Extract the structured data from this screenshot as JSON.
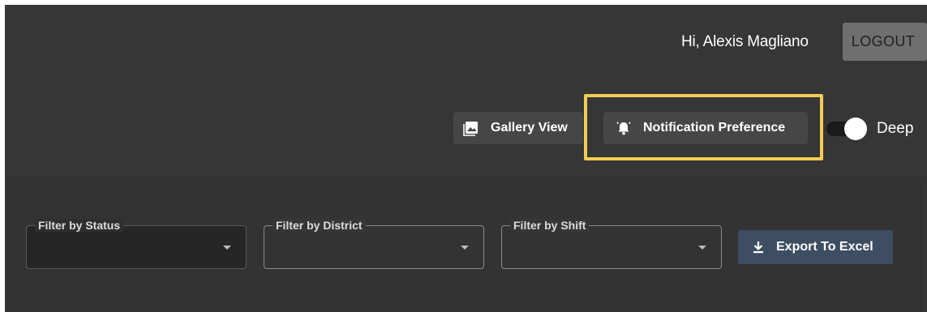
{
  "header": {
    "greeting": "Hi, Alexis Magliano",
    "logout_label": "LOGOUT"
  },
  "toolbar": {
    "gallery_view_label": "Gallery View",
    "gallery_icon": "image-icon",
    "notification_preference_label": "Notification Preference",
    "notification_icon": "bell-icon",
    "theme_toggle_label": "Deep",
    "theme_toggle_on": true,
    "highlight_color": "#f2cc55"
  },
  "filters": {
    "status": {
      "label": "Filter by Status",
      "value": ""
    },
    "district": {
      "label": "Filter by District",
      "value": ""
    },
    "shift": {
      "label": "Filter by Shift",
      "value": ""
    }
  },
  "export": {
    "label": "Export To Excel",
    "icon": "download-icon",
    "color": "#3d4e62"
  }
}
